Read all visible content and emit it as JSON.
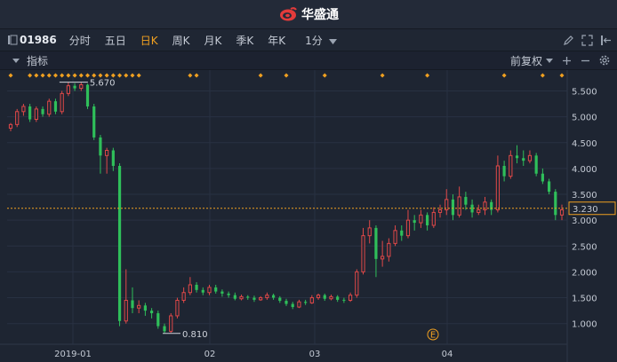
{
  "app": {
    "brand": "华盛通",
    "accent": "#f0a020",
    "up_color": "#e04848",
    "down_color": "#2fbf5a"
  },
  "toolbar": {
    "stock_code": "01986",
    "periods": [
      "分时",
      "五日",
      "日K",
      "周K",
      "月K",
      "季K",
      "年K"
    ],
    "active_period": "日K",
    "interval": "1分"
  },
  "subbar": {
    "indicators_label": "指标",
    "adjust_label": "前复权"
  },
  "chart_data": {
    "type": "candlestick",
    "y_ticks": [
      "5.500",
      "5.000",
      "4.500",
      "4.000",
      "3.500",
      "3.000",
      "2.500",
      "2.000",
      "1.500",
      "1.000"
    ],
    "ylim": [
      0.6,
      5.8
    ],
    "x_ticks": [
      "2019-01",
      "02",
      "03",
      "04"
    ],
    "current_price": "3.230",
    "high_annotation": "5.670",
    "low_annotation": "0.810",
    "event_marker": "E",
    "candles": [
      [
        4.78,
        4.85,
        4.72,
        4.88
      ],
      [
        4.85,
        5.1,
        4.8,
        5.15
      ],
      [
        5.1,
        5.2,
        5.02,
        5.25
      ],
      [
        5.2,
        4.95,
        4.9,
        5.25
      ],
      [
        4.95,
        5.15,
        4.9,
        5.2
      ],
      [
        5.15,
        5.05,
        5.0,
        5.2
      ],
      [
        5.05,
        5.3,
        5.0,
        5.35
      ],
      [
        5.3,
        5.1,
        5.05,
        5.35
      ],
      [
        5.1,
        5.45,
        5.05,
        5.5
      ],
      [
        5.45,
        5.6,
        5.4,
        5.67
      ],
      [
        5.6,
        5.55,
        5.5,
        5.65
      ],
      [
        5.55,
        5.62,
        5.5,
        5.66
      ],
      [
        5.62,
        5.2,
        5.15,
        5.64
      ],
      [
        5.2,
        4.6,
        4.55,
        5.25
      ],
      [
        4.6,
        4.25,
        3.9,
        4.65
      ],
      [
        4.25,
        4.35,
        3.9,
        4.4
      ],
      [
        4.35,
        4.05,
        3.95,
        4.4
      ],
      [
        4.05,
        1.05,
        0.95,
        4.1
      ],
      [
        1.05,
        1.45,
        1.0,
        2.05
      ],
      [
        1.45,
        1.3,
        1.2,
        1.7
      ],
      [
        1.3,
        1.35,
        1.2,
        1.45
      ],
      [
        1.35,
        1.25,
        1.15,
        1.4
      ],
      [
        1.25,
        1.2,
        1.1,
        1.3
      ],
      [
        1.2,
        0.95,
        0.9,
        1.25
      ],
      [
        0.95,
        0.85,
        0.81,
        1.0
      ],
      [
        0.85,
        1.15,
        0.82,
        1.2
      ],
      [
        1.15,
        1.45,
        1.1,
        1.5
      ],
      [
        1.45,
        1.6,
        1.4,
        1.7
      ],
      [
        1.6,
        1.75,
        1.55,
        1.9
      ],
      [
        1.75,
        1.65,
        1.6,
        1.8
      ],
      [
        1.65,
        1.6,
        1.55,
        1.7
      ],
      [
        1.6,
        1.7,
        1.55,
        1.75
      ],
      [
        1.7,
        1.62,
        1.58,
        1.75
      ],
      [
        1.62,
        1.58,
        1.52,
        1.66
      ],
      [
        1.58,
        1.55,
        1.5,
        1.62
      ],
      [
        1.55,
        1.48,
        1.45,
        1.6
      ],
      [
        1.48,
        1.52,
        1.45,
        1.56
      ],
      [
        1.52,
        1.5,
        1.46,
        1.55
      ],
      [
        1.5,
        1.46,
        1.42,
        1.54
      ],
      [
        1.46,
        1.5,
        1.44,
        1.53
      ],
      [
        1.5,
        1.55,
        1.46,
        1.6
      ],
      [
        1.55,
        1.5,
        1.46,
        1.58
      ],
      [
        1.5,
        1.44,
        1.4,
        1.53
      ],
      [
        1.44,
        1.38,
        1.34,
        1.48
      ],
      [
        1.38,
        1.32,
        1.28,
        1.42
      ],
      [
        1.32,
        1.42,
        1.3,
        1.46
      ],
      [
        1.42,
        1.4,
        1.36,
        1.46
      ],
      [
        1.4,
        1.5,
        1.38,
        1.55
      ],
      [
        1.5,
        1.55,
        1.46,
        1.58
      ],
      [
        1.55,
        1.48,
        1.44,
        1.58
      ],
      [
        1.48,
        1.52,
        1.45,
        1.56
      ],
      [
        1.52,
        1.46,
        1.42,
        1.55
      ],
      [
        1.46,
        1.45,
        1.4,
        1.5
      ],
      [
        1.45,
        1.55,
        1.42,
        1.6
      ],
      [
        1.55,
        2.0,
        1.5,
        2.05
      ],
      [
        2.0,
        2.7,
        1.95,
        2.85
      ],
      [
        2.7,
        2.85,
        2.55,
        3.0
      ],
      [
        2.85,
        2.25,
        1.9,
        2.9
      ],
      [
        2.25,
        2.3,
        2.1,
        2.6
      ],
      [
        2.3,
        2.55,
        2.2,
        2.65
      ],
      [
        2.55,
        2.8,
        2.5,
        2.9
      ],
      [
        2.8,
        2.7,
        2.6,
        2.9
      ],
      [
        2.7,
        3.0,
        2.65,
        3.2
      ],
      [
        3.0,
        2.95,
        2.8,
        3.1
      ],
      [
        2.95,
        3.1,
        2.85,
        3.2
      ],
      [
        3.1,
        2.9,
        2.8,
        3.15
      ],
      [
        2.9,
        3.15,
        2.85,
        3.25
      ],
      [
        3.15,
        3.2,
        3.05,
        3.3
      ],
      [
        3.2,
        3.4,
        3.1,
        3.6
      ],
      [
        3.4,
        3.1,
        3.0,
        3.5
      ],
      [
        3.1,
        3.45,
        3.05,
        3.65
      ],
      [
        3.45,
        3.3,
        3.2,
        3.55
      ],
      [
        3.3,
        3.15,
        3.05,
        3.4
      ],
      [
        3.15,
        3.2,
        3.1,
        3.3
      ],
      [
        3.2,
        3.35,
        3.1,
        3.45
      ],
      [
        3.35,
        3.2,
        3.1,
        3.4
      ],
      [
        3.2,
        4.05,
        3.15,
        4.25
      ],
      [
        4.05,
        3.85,
        3.75,
        4.15
      ],
      [
        3.85,
        4.25,
        3.8,
        4.35
      ],
      [
        4.25,
        4.2,
        4.1,
        4.45
      ],
      [
        4.2,
        4.15,
        4.05,
        4.35
      ],
      [
        4.15,
        4.25,
        4.1,
        4.35
      ],
      [
        4.25,
        3.9,
        3.85,
        4.3
      ],
      [
        3.9,
        3.75,
        3.7,
        4.0
      ],
      [
        3.75,
        3.55,
        3.5,
        3.8
      ],
      [
        3.55,
        3.1,
        3.0,
        3.6
      ],
      [
        3.1,
        3.2,
        3.0,
        3.3
      ]
    ]
  }
}
